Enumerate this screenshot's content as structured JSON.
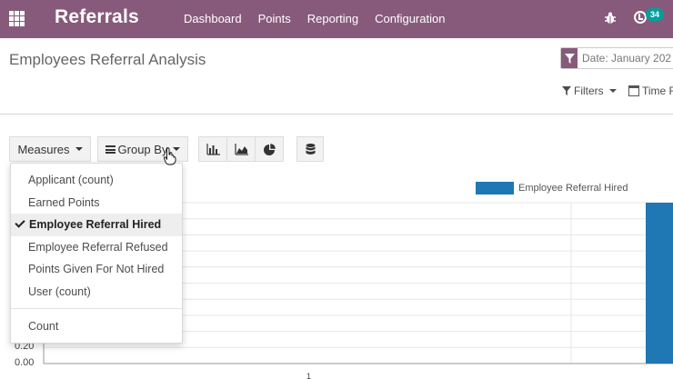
{
  "navbar": {
    "app_name": "Referrals",
    "menu": [
      "Dashboard",
      "Points",
      "Reporting",
      "Configuration"
    ],
    "activity_count": "34",
    "bg_color": "#875a7b",
    "icons": [
      "apps-grid-icon",
      "bug-icon",
      "activity-icon"
    ]
  },
  "control_panel": {
    "title": "Employees Referral Analysis",
    "facet_value": "Date: January 202",
    "filters_label": "Filters",
    "timerange_label": "Time R",
    "icons": [
      "filter-icon",
      "calendar-icon"
    ]
  },
  "toolbar": {
    "measures_label": "Measures",
    "groupby_label": "Group By",
    "modes": [
      "bar-chart-icon",
      "line-chart-icon",
      "pie-chart-icon"
    ],
    "active_mode": "bar",
    "stacked_icon": "database-icon"
  },
  "measures_menu": {
    "items": [
      {
        "label": "Applicant (count)",
        "selected": false
      },
      {
        "label": "Earned Points",
        "selected": false
      },
      {
        "label": "Employee Referral Hired",
        "selected": true
      },
      {
        "label": "Employee Referral Refused",
        "selected": false
      },
      {
        "label": "Points Given For Not Hired",
        "selected": false
      },
      {
        "label": "User (count)",
        "selected": false
      }
    ],
    "count_label": "Count"
  },
  "chart_data": {
    "type": "bar",
    "categories": [
      "1"
    ],
    "series": [
      {
        "name": "Employee Referral Hired",
        "values": [
          1
        ],
        "color": "#1f77b4"
      }
    ],
    "ylim": [
      0,
      1
    ],
    "y_ticks_visible": [
      "0.20",
      "0.00"
    ],
    "grid": true,
    "legend": "top-right"
  }
}
